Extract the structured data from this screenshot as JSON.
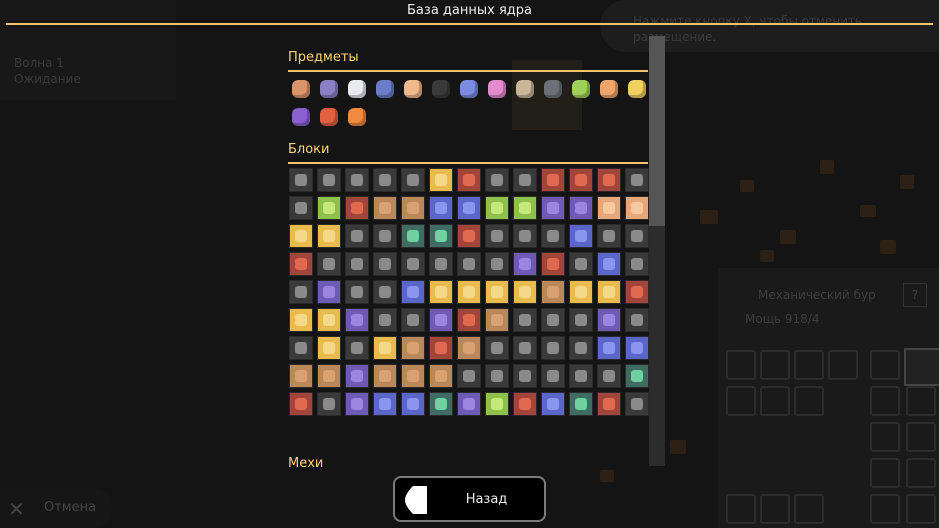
{
  "title": "База данных ядра",
  "background": {
    "wave_text": "Волна 1",
    "wave_sub": "Ожидание",
    "hint": "Нажмите кнопку X, чтобы отменить размещение.",
    "block_name": "Механический бур",
    "block_stat": "Мощь 918/4",
    "help": "?",
    "cancel_label": "Отмена"
  },
  "sections": {
    "items_label": "Предметы",
    "blocks_label": "Блоки",
    "mechs_label": "Мехи"
  },
  "items": [
    {
      "name": "copper",
      "color": "#d9946a"
    },
    {
      "name": "lead",
      "color": "#8b7fc4"
    },
    {
      "name": "metaglass",
      "color": "#e9e9f0"
    },
    {
      "name": "graphite",
      "color": "#6b7cc9"
    },
    {
      "name": "sand",
      "color": "#f0b98b"
    },
    {
      "name": "coal",
      "color": "#3a3a3a"
    },
    {
      "name": "titanium",
      "color": "#7a8be0"
    },
    {
      "name": "thorium",
      "color": "#e58bd0"
    },
    {
      "name": "scrap",
      "color": "#c9b79a"
    },
    {
      "name": "silicon",
      "color": "#6f6f7a"
    },
    {
      "name": "plastanium",
      "color": "#9fd05a"
    },
    {
      "name": "phase-fabric",
      "color": "#f0a56b"
    },
    {
      "name": "surge-alloy",
      "color": "#f0d060"
    },
    {
      "name": "spore-pod",
      "color": "#8a5fd0"
    },
    {
      "name": "blast-compound",
      "color": "#e06040"
    },
    {
      "name": "pyratite",
      "color": "#f08a40"
    }
  ],
  "blocks": [
    "dark",
    "dark",
    "dark",
    "dark",
    "dark",
    "gold",
    "red",
    "dark",
    "dark",
    "red",
    "red",
    "red",
    "dark",
    "dark",
    "lime",
    "red",
    "tan",
    "tan",
    "blue",
    "blue",
    "lime",
    "lime",
    "purple",
    "purple",
    "peach",
    "peach",
    "gold",
    "gold",
    "dark",
    "dark",
    "teal",
    "teal",
    "red",
    "dark",
    "dark",
    "dark",
    "blue",
    "dark",
    "dark",
    "red",
    "dark",
    "dark",
    "dark",
    "dark",
    "dark",
    "dark",
    "dark",
    "purple",
    "red",
    "dark",
    "blue",
    "dark",
    "dark",
    "purple",
    "dark",
    "dark",
    "blue",
    "gold",
    "gold",
    "gold",
    "gold",
    "tan",
    "gold",
    "gold",
    "red",
    "gold",
    "gold",
    "purple",
    "dark",
    "dark",
    "purple",
    "red",
    "tan",
    "dark",
    "dark",
    "dark",
    "purple",
    "dark",
    "dark",
    "gold",
    "dark",
    "gold",
    "tan",
    "red",
    "tan",
    "dark",
    "dark",
    "dark",
    "dark",
    "blue",
    "blue",
    "tan",
    "tan",
    "purple",
    "tan",
    "tan",
    "tan",
    "dark",
    "dark",
    "dark",
    "dark",
    "dark",
    "dark",
    "teal",
    "red",
    "dark",
    "purple",
    "blue",
    "blue",
    "teal",
    "purple",
    "lime",
    "red",
    "blue",
    "teal",
    "red",
    "dark"
  ],
  "back_button": {
    "label": "Назад"
  }
}
